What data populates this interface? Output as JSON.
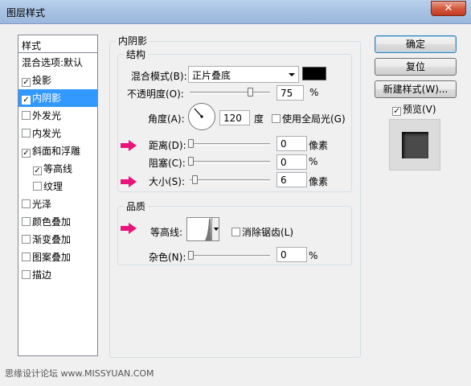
{
  "window": {
    "title": "图层样式",
    "close_glyph": "✕"
  },
  "left_panel": {
    "header": "样式",
    "items": [
      {
        "label": "混合选项:默认",
        "checkbox": false,
        "checked": false,
        "indent": false,
        "selected": false
      },
      {
        "label": "投影",
        "checkbox": true,
        "checked": true,
        "indent": false,
        "selected": false
      },
      {
        "label": "内阴影",
        "checkbox": true,
        "checked": true,
        "indent": false,
        "selected": true
      },
      {
        "label": "外发光",
        "checkbox": true,
        "checked": false,
        "indent": false,
        "selected": false
      },
      {
        "label": "内发光",
        "checkbox": true,
        "checked": false,
        "indent": false,
        "selected": false
      },
      {
        "label": "斜面和浮雕",
        "checkbox": true,
        "checked": true,
        "indent": false,
        "selected": false
      },
      {
        "label": "等高线",
        "checkbox": true,
        "checked": true,
        "indent": true,
        "selected": false
      },
      {
        "label": "纹理",
        "checkbox": true,
        "checked": false,
        "indent": true,
        "selected": false
      },
      {
        "label": "光泽",
        "checkbox": true,
        "checked": false,
        "indent": false,
        "selected": false
      },
      {
        "label": "颜色叠加",
        "checkbox": true,
        "checked": false,
        "indent": false,
        "selected": false
      },
      {
        "label": "渐变叠加",
        "checkbox": true,
        "checked": false,
        "indent": false,
        "selected": false
      },
      {
        "label": "图案叠加",
        "checkbox": true,
        "checked": false,
        "indent": false,
        "selected": false
      },
      {
        "label": "描边",
        "checkbox": true,
        "checked": false,
        "indent": false,
        "selected": false
      }
    ]
  },
  "inner_shadow": {
    "title": "内阴影",
    "structure": {
      "title": "结构",
      "blend_mode_label": "混合模式(B):",
      "blend_mode_value": "正片叠底",
      "color": "#000000",
      "opacity_label": "不透明度(O):",
      "opacity_value": "75",
      "opacity_unit": "%",
      "angle_label": "角度(A):",
      "angle_value": "120",
      "angle_unit": "度",
      "global_light_label": "使用全局光(G)",
      "global_light_checked": false,
      "distance_label": "距离(D):",
      "distance_value": "0",
      "distance_unit": "像素",
      "choke_label": "阻塞(C):",
      "choke_value": "0",
      "choke_unit": "%",
      "size_label": "大小(S):",
      "size_value": "6",
      "size_unit": "像素"
    },
    "quality": {
      "title": "品质",
      "contour_label": "等高线:",
      "anti_alias_label": "消除锯齿(L)",
      "anti_alias_checked": false,
      "noise_label": "杂色(N):",
      "noise_value": "0",
      "noise_unit": "%"
    }
  },
  "buttons": {
    "ok": "确定",
    "reset": "复位",
    "new_style": "新建样式(W)...",
    "preview_label": "预览(V)",
    "preview_checked": true
  },
  "watermark": "思缘设计论坛 www.MISSYUAN.COM",
  "colors": {
    "accent": "#3399ff",
    "marker_arrow": "#e8147a"
  },
  "icons": {
    "arrow_marker": "pink-arrow-icon",
    "dial": "angle-dial-icon",
    "check": "checkmark-icon"
  }
}
